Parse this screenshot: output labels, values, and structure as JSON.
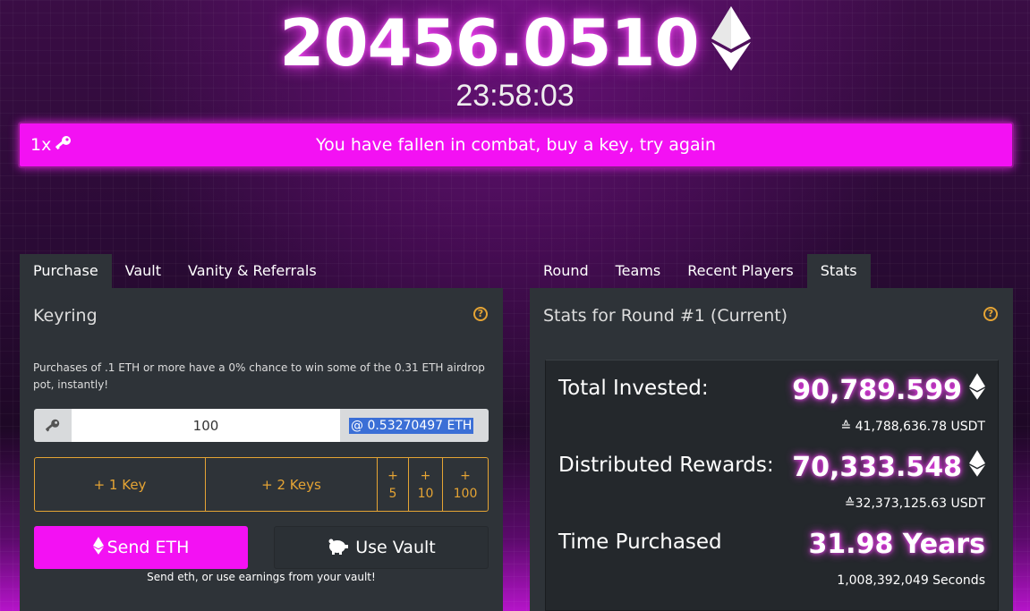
{
  "header": {
    "pot": "20456.0510",
    "timer": "23:58:03"
  },
  "banner": {
    "key_count": "1x",
    "message": "You have fallen in combat, buy a key, try again"
  },
  "left": {
    "tabs": [
      "Purchase",
      "Vault",
      "Vanity & Referrals"
    ],
    "active_tab": "Purchase",
    "title": "Keyring",
    "airdrop_note": "Purchases of .1 ETH or more have a 0% chance to win some of the 0.31 ETH airdrop pot, instantly!",
    "key_amount": "100",
    "price": "@ 0.53270497 ETH",
    "buttons": {
      "one_key": "+ 1 Key",
      "two_keys": "+ 2 Keys",
      "plus5_top": "+",
      "plus5_bottom": "5",
      "plus10_top": "+",
      "plus10_bottom": "10",
      "plus100_top": "+",
      "plus100_bottom": "100"
    },
    "send_eth": "Send ETH",
    "use_vault": "Use Vault",
    "send_note": "Send eth, or use earnings from your vault!"
  },
  "right": {
    "tabs": [
      "Round",
      "Teams",
      "Recent Players",
      "Stats"
    ],
    "active_tab": "Stats",
    "title": "Stats for Round #1 (Current)",
    "stats": {
      "total_invested_label": "Total Invested:",
      "total_invested_value": "90,789.599",
      "total_invested_usdt": "≙ 41,788,636.78 USDT",
      "distributed_label": "Distributed Rewards:",
      "distributed_value": "70,333.548",
      "distributed_usdt": "≙32,373,125.63 USDT",
      "time_label": "Time Purchased",
      "time_value": "31.98 Years",
      "time_seconds": "1,008,392,049 Seconds"
    }
  },
  "colors": {
    "accent_pink": "#f311f3",
    "gold": "#e5a434",
    "panel": "#2e3338"
  },
  "icons": [
    "eth-icon",
    "key-icon",
    "help-icon",
    "piggy-bank-icon"
  ]
}
